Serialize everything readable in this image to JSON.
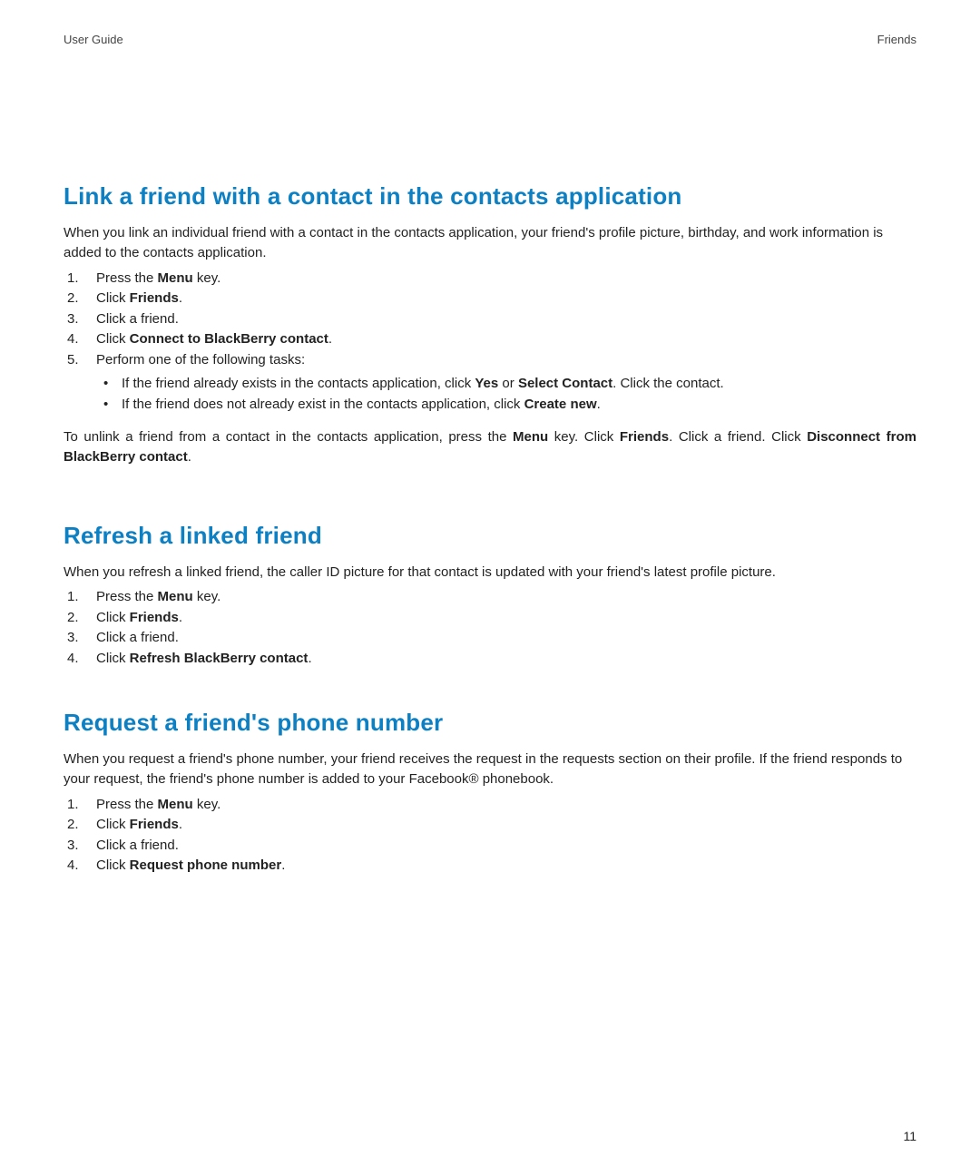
{
  "header": {
    "left": "User Guide",
    "right": "Friends"
  },
  "page_number": "11",
  "sections": {
    "link": {
      "title": "Link a friend with a contact in the contacts application",
      "intro": "When you link an individual friend with a contact in the contacts application, your friend's profile picture, birthday, and work information is added to the contacts application.",
      "steps": {
        "s1_pre": "Press the ",
        "s1_bold": "Menu",
        "s1_post": " key.",
        "s2_pre": "Click ",
        "s2_bold": "Friends",
        "s2_post": ".",
        "s3": "Click a friend.",
        "s4_pre": "Click ",
        "s4_bold": "Connect to BlackBerry contact",
        "s4_post": ".",
        "s5": "Perform one of the following tasks:",
        "s5a_pre": "If the friend already exists in the contacts application, click ",
        "s5a_b1": "Yes",
        "s5a_mid": " or ",
        "s5a_b2": "Select Contact",
        "s5a_post": ". Click the contact.",
        "s5b_pre": "If the friend does not already exist in the contacts application, click ",
        "s5b_b": "Create new",
        "s5b_post": "."
      },
      "unlink": {
        "p1": "To unlink a friend from a contact in the contacts application, press the ",
        "b1": "Menu",
        "p2": " key. Click ",
        "b2": "Friends",
        "p3": ". Click a friend. Click ",
        "b3": "Disconnect from BlackBerry contact",
        "p4": "."
      }
    },
    "refresh": {
      "title": "Refresh a linked friend",
      "intro": "When you refresh a linked friend, the caller ID picture for that contact is updated with your friend's latest profile picture.",
      "steps": {
        "s1_pre": "Press the ",
        "s1_bold": "Menu",
        "s1_post": " key.",
        "s2_pre": "Click ",
        "s2_bold": "Friends",
        "s2_post": ".",
        "s3": "Click a friend.",
        "s4_pre": "Click ",
        "s4_bold": "Refresh BlackBerry contact",
        "s4_post": "."
      }
    },
    "request": {
      "title": "Request a friend's phone number",
      "intro": "When you request a friend's phone number, your friend receives the request in the requests section on their profile. If the friend responds to your request, the friend's phone number is added to your Facebook® phonebook.",
      "steps": {
        "s1_pre": "Press the ",
        "s1_bold": "Menu",
        "s1_post": " key.",
        "s2_pre": "Click ",
        "s2_bold": "Friends",
        "s2_post": ".",
        "s3": "Click a friend.",
        "s4_pre": "Click ",
        "s4_bold": "Request phone number",
        "s4_post": "."
      }
    }
  }
}
